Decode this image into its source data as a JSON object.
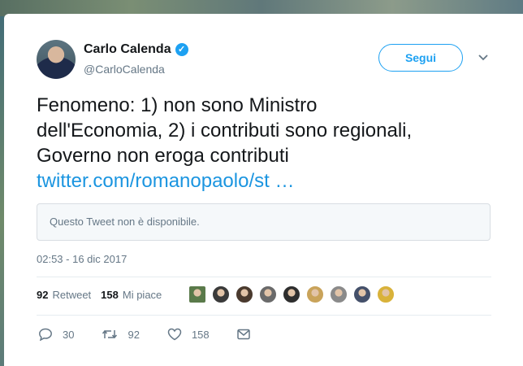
{
  "author": {
    "name": "Carlo Calenda",
    "handle": "@CarloCalenda",
    "verified_icon": "verified-badge-icon"
  },
  "follow_button": {
    "label": "Segui"
  },
  "menu": {
    "icon": "chevron-down-icon"
  },
  "tweet": {
    "lines": [
      "Fenomeno: 1) non sono Ministro",
      "dell'Economia, 2) i contributi sono regionali,",
      "Governo non eroga contributi"
    ],
    "link_text": "twitter.com/romanopaolo/st …"
  },
  "quoted_tweet": {
    "text": "Questo Tweet non è disponibile."
  },
  "timestamp": "02:53 - 16 dic 2017",
  "stats": {
    "retweets_count": "92",
    "retweets_label": "Retweet",
    "likes_count": "158",
    "likes_label": "Mi piace"
  },
  "likers": [
    {
      "color": "#5a7a4a"
    },
    {
      "color": "#3a3a3a"
    },
    {
      "color": "#4a3a2e"
    },
    {
      "color": "#6a6a6a"
    },
    {
      "color": "#2e2e2e"
    },
    {
      "color": "#c9a35a"
    },
    {
      "color": "#8a8a8a"
    },
    {
      "color": "#44506a"
    },
    {
      "color": "#d9b23a"
    }
  ],
  "actions": {
    "reply_count": "30",
    "retweet_count": "92",
    "like_count": "158"
  },
  "colors": {
    "accent": "#1da1f2",
    "link": "#1b95e0",
    "text": "#14171a",
    "muted": "#657786"
  }
}
